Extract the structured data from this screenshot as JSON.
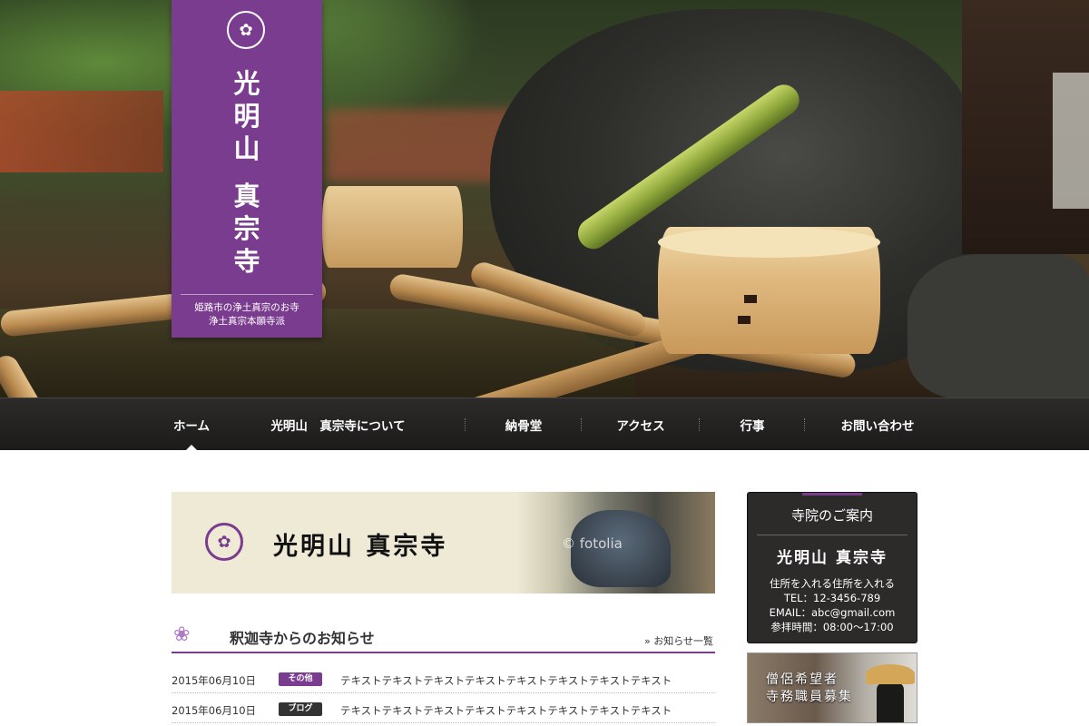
{
  "hero_banner": {
    "name_lines": [
      "光",
      "明",
      "山",
      "",
      "真",
      "宗",
      "寺"
    ],
    "sub_line1": "姫路市の浄土真宗のお寺",
    "sub_line2": "浄土真宗本願寺派"
  },
  "nav": {
    "items": [
      {
        "label": "ホーム",
        "active": true
      },
      {
        "label": "光明山　真宗寺について",
        "active": false
      },
      {
        "label": "納骨堂",
        "active": false
      },
      {
        "label": "アクセス",
        "active": false
      },
      {
        "label": "行事",
        "active": false
      },
      {
        "label": "お問い合わせ",
        "active": false
      }
    ]
  },
  "main_banner": {
    "title": "光明山 真宗寺",
    "watermark": "© fotolia"
  },
  "news": {
    "heading": "釈迦寺からのお知らせ",
    "more_link": "» お知らせ一覧",
    "rows": [
      {
        "date": "2015年06月10日",
        "badge": "その他",
        "badge_color": "#7a3c8e",
        "text": "テキストテキストテキストテキストテキストテキストテキストテキスト"
      },
      {
        "date": "2015年06月10日",
        "badge": "ブログ",
        "badge_color": "#333333",
        "text": "テキストテキストテキストテキストテキストテキストテキストテキスト"
      }
    ]
  },
  "sidebar": {
    "info_heading": "寺院のご案内",
    "info_name": "光明山 真宗寺",
    "address": "住所を入れる住所を入れる",
    "tel": "TEL：12-3456-789",
    "email": "EMAIL：abc@gmail.com",
    "hours": "参拝時間：08:00〜17:00",
    "recruit_line1": "僧侶希望者",
    "recruit_line2": "寺務職員募集"
  },
  "colors": {
    "accent": "#7a3c8e",
    "nav_bg": "#1f1e1d"
  },
  "icons": {
    "crest": "family-crest-icon",
    "lotus": "lotus-icon"
  }
}
